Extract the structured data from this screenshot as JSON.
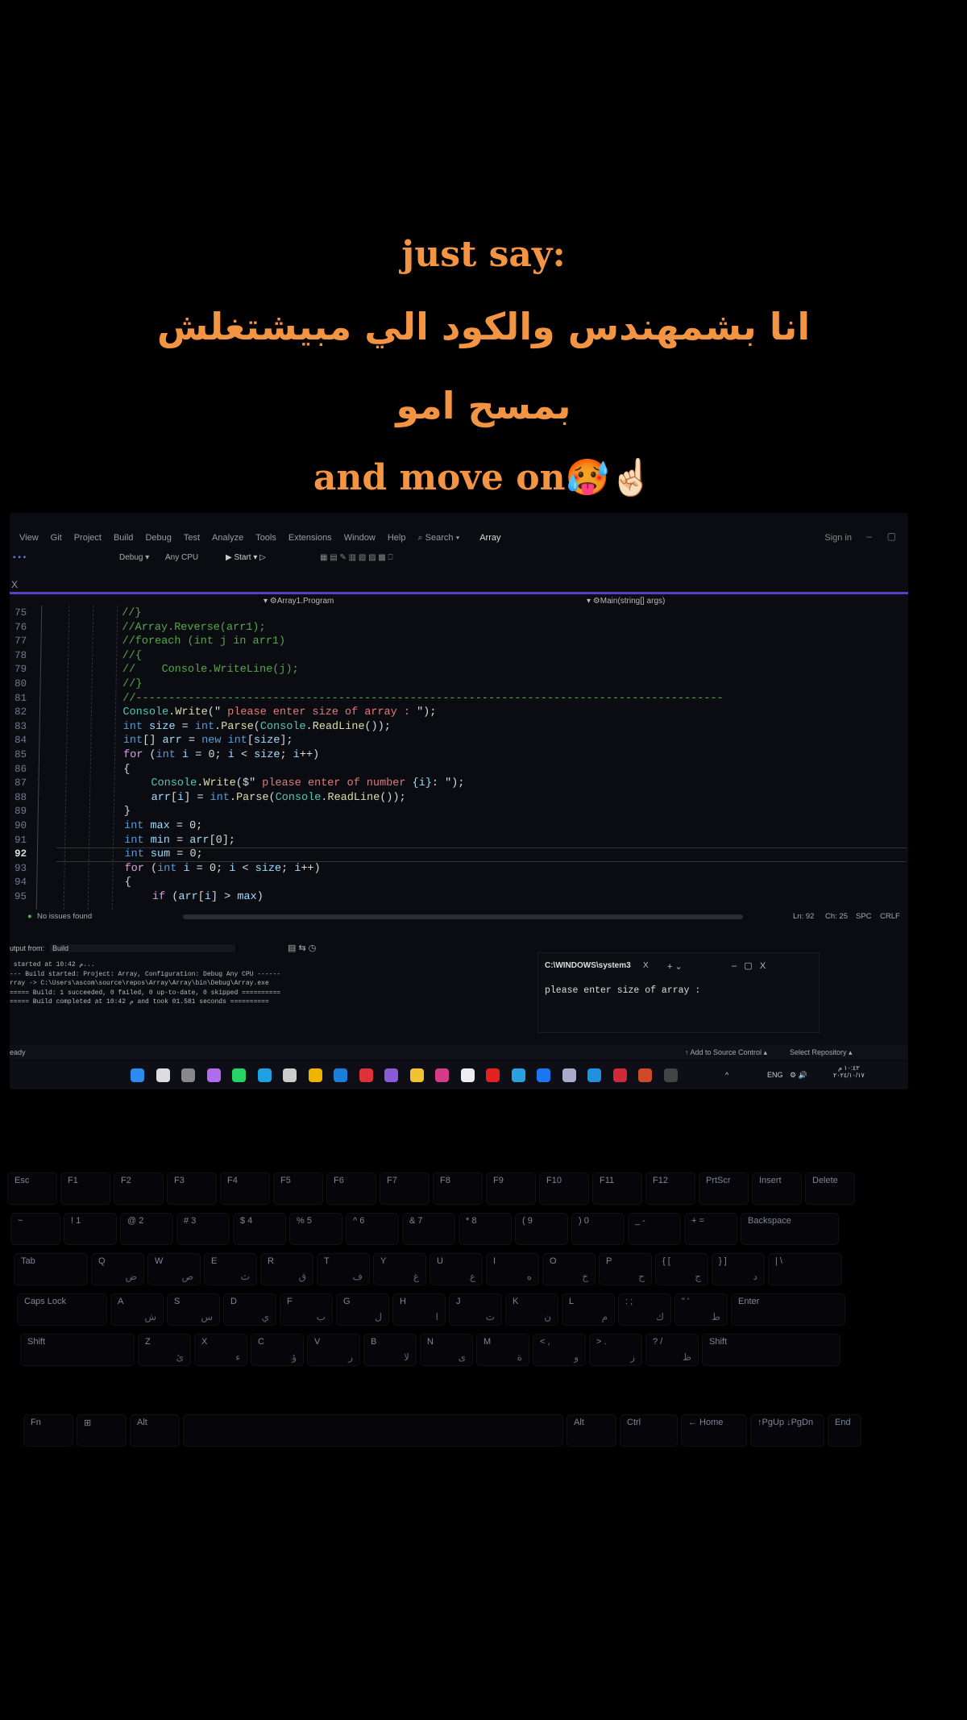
{
  "caption": {
    "line1": "just say:",
    "line2": "انا بشمهندس والكود الي مبيشتغلش",
    "line3": "بمسح امو",
    "line4": "and move on🥵☝🏻"
  },
  "ide": {
    "menu": [
      "View",
      "Git",
      "Project",
      "Build",
      "Debug",
      "Test",
      "Analyze",
      "Tools",
      "Extensions",
      "Window",
      "Help"
    ],
    "search": "⌕ Search ▾",
    "title": "Array",
    "sign_in": "Sign in",
    "toolbar": {
      "config": "Debug ▾",
      "platform": "Any CPU",
      "start": "▶ Start ▾ ▷"
    },
    "close": "X",
    "nav_left": "▾ ⚙Array1.Program",
    "nav_right": "▾ ⚙Main(string[] args)",
    "code": [
      {
        "n": "75",
        "t": [
          [
            "//}",
            "cm"
          ]
        ],
        "i": 0
      },
      {
        "n": "76",
        "t": [
          [
            "//Array.Reverse(arr1);",
            "cm"
          ]
        ],
        "i": 0
      },
      {
        "n": "77",
        "t": [
          [
            "//foreach (int j in arr1)",
            "cm"
          ]
        ],
        "i": 0
      },
      {
        "n": "78",
        "t": [
          [
            "//{",
            "cm"
          ]
        ],
        "i": 0
      },
      {
        "n": "79",
        "t": [
          [
            "//    Console.WriteLine(j);",
            "cm"
          ]
        ],
        "i": 0
      },
      {
        "n": "80",
        "t": [
          [
            "//}",
            "cm"
          ]
        ],
        "i": 0
      },
      {
        "n": "81",
        "t": [
          [
            "//------------------------------------------------------------------------------------------",
            "cm"
          ]
        ],
        "i": 0
      },
      {
        "n": "82",
        "t": [
          [
            "Console",
            "ty"
          ],
          [
            ".",
            "pl"
          ],
          [
            "Write",
            "fn"
          ],
          [
            "(\"",
            "pl"
          ],
          [
            " please enter size of array : ",
            "st"
          ],
          [
            "\");",
            "pl"
          ]
        ],
        "i": 0
      },
      {
        "n": "83",
        "t": [
          [
            "int ",
            "kw"
          ],
          [
            "size",
            "va"
          ],
          [
            " = ",
            "pl"
          ],
          [
            "int",
            "kw"
          ],
          [
            ".",
            "pl"
          ],
          [
            "Parse",
            "fn"
          ],
          [
            "(",
            "pl"
          ],
          [
            "Console",
            "ty"
          ],
          [
            ".",
            "pl"
          ],
          [
            "ReadLine",
            "fn"
          ],
          [
            "());",
            "pl"
          ]
        ],
        "i": 0
      },
      {
        "n": "84",
        "t": [
          [
            "int",
            "kw"
          ],
          [
            "[] ",
            "pl"
          ],
          [
            "arr",
            "va"
          ],
          [
            " = ",
            "pl"
          ],
          [
            "new ",
            "kw"
          ],
          [
            "int",
            "kw"
          ],
          [
            "[",
            "pl"
          ],
          [
            "size",
            "va"
          ],
          [
            "];",
            "pl"
          ]
        ],
        "i": 0
      },
      {
        "n": "85",
        "t": [
          [
            "for ",
            "pu"
          ],
          [
            "(",
            "pl"
          ],
          [
            "int ",
            "kw"
          ],
          [
            "i",
            "va"
          ],
          [
            " = 0; ",
            "pl"
          ],
          [
            "i",
            "va"
          ],
          [
            " < ",
            "pl"
          ],
          [
            "size",
            "va"
          ],
          [
            "; ",
            "pl"
          ],
          [
            "i",
            "va"
          ],
          [
            "++)",
            "pl"
          ]
        ],
        "i": 0
      },
      {
        "n": "86",
        "t": [
          [
            "{",
            "pl"
          ]
        ],
        "i": 0
      },
      {
        "n": "87",
        "t": [
          [
            "Console",
            "ty"
          ],
          [
            ".",
            "pl"
          ],
          [
            "Write",
            "fn"
          ],
          [
            "($\"",
            "pl"
          ],
          [
            " please enter of number ",
            "st"
          ],
          [
            "{i}",
            "va"
          ],
          [
            ": \");",
            "pl"
          ]
        ],
        "i": 1
      },
      {
        "n": "88",
        "t": [
          [
            "arr",
            "va"
          ],
          [
            "[",
            "pl"
          ],
          [
            "i",
            "va"
          ],
          [
            "] = ",
            "pl"
          ],
          [
            "int",
            "kw"
          ],
          [
            ".",
            "pl"
          ],
          [
            "Parse",
            "fn"
          ],
          [
            "(",
            "pl"
          ],
          [
            "Console",
            "ty"
          ],
          [
            ".",
            "pl"
          ],
          [
            "ReadLine",
            "fn"
          ],
          [
            "());",
            "pl"
          ]
        ],
        "i": 1
      },
      {
        "n": "89",
        "t": [
          [
            "}",
            "pl"
          ]
        ],
        "i": 0
      },
      {
        "n": "90",
        "t": [
          [
            "int ",
            "kw"
          ],
          [
            "max",
            "va"
          ],
          [
            " = 0;",
            "pl"
          ]
        ],
        "i": 0
      },
      {
        "n": "91",
        "t": [
          [
            "int ",
            "kw"
          ],
          [
            "min",
            "va"
          ],
          [
            " = ",
            "pl"
          ],
          [
            "arr",
            "va"
          ],
          [
            "[0];",
            "pl"
          ]
        ],
        "i": 0
      },
      {
        "n": "92",
        "t": [
          [
            "int ",
            "kw"
          ],
          [
            "sum",
            "va"
          ],
          [
            " = 0;",
            "pl"
          ]
        ],
        "i": 0,
        "cur": true
      },
      {
        "n": "93",
        "t": [
          [
            "for ",
            "pu"
          ],
          [
            "(",
            "pl"
          ],
          [
            "int ",
            "kw"
          ],
          [
            "i",
            "va"
          ],
          [
            " = 0; ",
            "pl"
          ],
          [
            "i",
            "va"
          ],
          [
            " < ",
            "pl"
          ],
          [
            "size",
            "va"
          ],
          [
            "; ",
            "pl"
          ],
          [
            "i",
            "va"
          ],
          [
            "++)",
            "pl"
          ]
        ],
        "i": 0
      },
      {
        "n": "94",
        "t": [
          [
            "{",
            "pl"
          ]
        ],
        "i": 0
      },
      {
        "n": "95",
        "t": [
          [
            "if ",
            "pu"
          ],
          [
            "(",
            "pl"
          ],
          [
            "arr",
            "va"
          ],
          [
            "[",
            "pl"
          ],
          [
            "i",
            "va"
          ],
          [
            "] > ",
            "pl"
          ],
          [
            "max",
            "va"
          ],
          [
            ")",
            "pl"
          ]
        ],
        "i": 1
      }
    ],
    "status": {
      "issues": "No issues found",
      "ln": "Ln: 92",
      "ch": "Ch: 25",
      "spc": "SPC",
      "crlf": "CRLF"
    },
    "output": {
      "from_label": "utput from:",
      "from_value": "Build",
      "lines": [
        " started at 10:42 م...",
        "--- Build started: Project: Array, Configuration: Debug Any CPU ------",
        "rray -> C:\\Users\\ascom\\source\\repos\\Array\\Array\\bin\\Debug\\Array.exe",
        "===== Build: 1 succeeded, 0 failed, 0 up-to-date, 0 skipped ==========",
        "===== Build completed at 10:42 م and took 01.581 seconds =========="
      ]
    },
    "console": {
      "tab": "C:\\WINDOWS\\system3",
      "close": "X",
      "plus": "+ ⌄",
      "controls": "–   ▢   X",
      "text": "please enter size of array :"
    },
    "ready": {
      "left": "eady",
      "source": "↑ Add to Source Control ▴",
      "repo": "Select Repository ▴"
    },
    "taskbar": {
      "icons": [
        {
          "name": "start",
          "color": "#2a8cf0"
        },
        {
          "name": "search",
          "color": "#ddd"
        },
        {
          "name": "task-view",
          "color": "#888"
        },
        {
          "name": "copilot",
          "color": "#b06cf0"
        },
        {
          "name": "whatsapp",
          "color": "#25d366"
        },
        {
          "name": "edge",
          "color": "#1fa0e0"
        },
        {
          "name": "calculator",
          "color": "#ccc"
        },
        {
          "name": "chrome",
          "color": "#f0b400"
        },
        {
          "name": "mail",
          "color": "#1a7fd8"
        },
        {
          "name": "wps",
          "color": "#e0303a"
        },
        {
          "name": "visual-studio",
          "color": "#8a5bd8"
        },
        {
          "name": "file-explorer",
          "color": "#f2c230"
        },
        {
          "name": "instagram",
          "color": "#d83a8a"
        },
        {
          "name": "tiktok",
          "color": "#eee"
        },
        {
          "name": "youtube",
          "color": "#e52020"
        },
        {
          "name": "telegram",
          "color": "#2aa0e0"
        },
        {
          "name": "facebook",
          "color": "#1a77f2"
        },
        {
          "name": "notepad",
          "color": "#aac"
        },
        {
          "name": "app",
          "color": "#2090e0"
        },
        {
          "name": "wps-pdf",
          "color": "#d02a3a"
        },
        {
          "name": "powerpoint",
          "color": "#d04a2a"
        },
        {
          "name": "terminal",
          "color": "#444"
        }
      ],
      "tray": {
        "lang": "ENG",
        "time": "١٠:٤٢ م",
        "date": "٢٠٢٤/١٠/١٧"
      }
    }
  },
  "keyboard": {
    "rows": [
      [
        [
          "Esc",
          ""
        ],
        [
          "F1",
          ""
        ],
        [
          "F2",
          ""
        ],
        [
          "F3",
          ""
        ],
        [
          "F4",
          ""
        ],
        [
          "F5",
          ""
        ],
        [
          "F6",
          ""
        ],
        [
          "F7",
          ""
        ],
        [
          "F8",
          ""
        ],
        [
          "F9",
          ""
        ],
        [
          "F10",
          ""
        ],
        [
          "F11",
          ""
        ],
        [
          "F12",
          ""
        ],
        [
          "PrtScr",
          ""
        ],
        [
          "Insert",
          ""
        ],
        [
          "Delete",
          ""
        ]
      ],
      [
        [
          "~",
          ""
        ],
        [
          "! 1",
          ""
        ],
        [
          "@ 2",
          ""
        ],
        [
          "# 3",
          ""
        ],
        [
          "$ 4",
          ""
        ],
        [
          "% 5",
          ""
        ],
        [
          "^ 6",
          ""
        ],
        [
          "& 7",
          ""
        ],
        [
          "* 8",
          ""
        ],
        [
          "( 9",
          ""
        ],
        [
          ") 0",
          ""
        ],
        [
          "_ -",
          ""
        ],
        [
          "+ =",
          ""
        ],
        [
          "Backspace",
          ""
        ]
      ],
      [
        [
          "Tab",
          ""
        ],
        [
          "Q",
          "ض"
        ],
        [
          "W",
          "ص"
        ],
        [
          "E",
          "ث"
        ],
        [
          "R",
          "ق"
        ],
        [
          "T",
          "ف"
        ],
        [
          "Y",
          "غ"
        ],
        [
          "U",
          "ع"
        ],
        [
          "I",
          "ه"
        ],
        [
          "O",
          "خ"
        ],
        [
          "P",
          "ح"
        ],
        [
          "{ [",
          "ج"
        ],
        [
          "} ]",
          "د"
        ],
        [
          "| \\",
          ""
        ]
      ],
      [
        [
          "Caps Lock",
          ""
        ],
        [
          "A",
          "ش"
        ],
        [
          "S",
          "س"
        ],
        [
          "D",
          "ي"
        ],
        [
          "F",
          "ب"
        ],
        [
          "G",
          "ل"
        ],
        [
          "H",
          "ا"
        ],
        [
          "J",
          "ت"
        ],
        [
          "K",
          "ن"
        ],
        [
          "L",
          "م"
        ],
        [
          ": ;",
          "ك"
        ],
        [
          "\" '",
          "ط"
        ],
        [
          "Enter",
          ""
        ]
      ],
      [
        [
          "Shift",
          ""
        ],
        [
          "Z",
          "ئ"
        ],
        [
          "X",
          "ء"
        ],
        [
          "C",
          "ؤ"
        ],
        [
          "V",
          "ر"
        ],
        [
          "B",
          "لا"
        ],
        [
          "N",
          "ى"
        ],
        [
          "M",
          "ة"
        ],
        [
          "< ,",
          "و"
        ],
        [
          "> .",
          "ز"
        ],
        [
          "? /",
          "ظ"
        ],
        [
          "Shift",
          ""
        ]
      ],
      [
        [
          "Fn",
          ""
        ],
        [
          "⊞",
          ""
        ],
        [
          "Alt",
          ""
        ],
        [
          "",
          ""
        ],
        [
          "Alt",
          ""
        ],
        [
          "Ctrl",
          ""
        ],
        [
          "← Home",
          ""
        ],
        [
          "↑PgUp ↓PgDn",
          ""
        ],
        [
          "End",
          ""
        ]
      ]
    ]
  }
}
